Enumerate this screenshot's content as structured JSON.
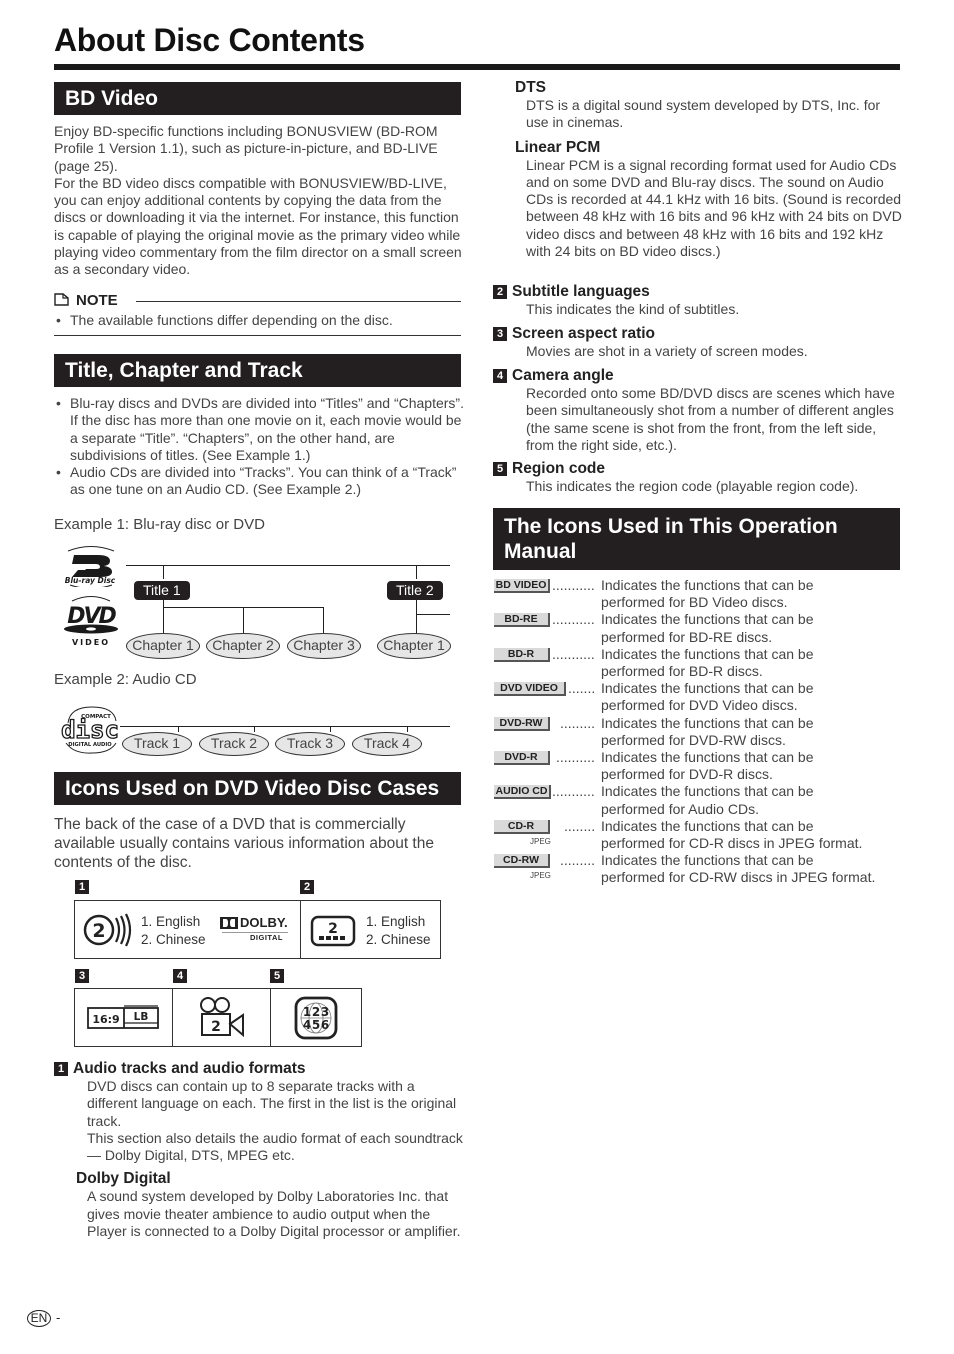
{
  "page": {
    "title": "About Disc Contents",
    "footer": {
      "lang_badge": "EN",
      "page_suffix": "-"
    }
  },
  "bd_video": {
    "heading": "BD Video",
    "paragraph1": "Enjoy BD-specific functions including BONUSVIEW (BD-ROM Profile 1 Version 1.1), such as picture-in-picture, and BD-LIVE (page 25).",
    "paragraph2": "For the BD video discs compatible with BONUSVIEW/BD-LIVE, you can enjoy additional contents by copying the data from the discs or downloading it via the internet. For instance, this function is capable of playing the original movie as the primary video while playing video commentary from the film director on a small screen as a secondary video.",
    "note_label": "NOTE",
    "note_items": [
      "The available functions differ depending on the disc."
    ]
  },
  "title_chapter_track": {
    "heading": "Title, Chapter and Track",
    "bullets": [
      "Blu-ray discs and DVDs are divided into “Titles” and “Chapters”. If the disc has more than one movie on it, each movie would be a separate “Title”. “Chapters”, on the other hand, are subdivisions of titles. (See Example 1.)",
      "Audio CDs are divided into “Tracks”. You can think of a “Track” as one tune on an Audio CD. (See Example 2.)"
    ],
    "example1": {
      "label": "Example 1: Blu-ray disc or DVD",
      "logos": [
        "Blu-ray Disc",
        "DVD VIDEO"
      ],
      "titles": [
        "Title 1",
        "Title 2"
      ],
      "chapters": [
        "Chapter 1",
        "Chapter 2",
        "Chapter 3",
        "Chapter 1"
      ]
    },
    "example2": {
      "label": "Example 2: Audio CD",
      "logo_top": "COMPACT",
      "logo_main": "disc",
      "logo_bottom": "DIGITAL AUDIO",
      "tracks": [
        "Track 1",
        "Track 2",
        "Track 3",
        "Track 4"
      ]
    }
  },
  "dvd_icons": {
    "heading": "Icons Used on DVD Video Disc Cases",
    "intro": "The back of the case of a DVD that is commercially available usually contains various information about the contents of the disc.",
    "panel": {
      "n1": "1",
      "n2": "2",
      "n3": "3",
      "n4": "4",
      "n5": "5",
      "audio_tracks_count": "2",
      "audio_langs": [
        "1. English",
        "2. Chinese"
      ],
      "dolby_main": "DOLBY.",
      "dolby_sub": "DIGITAL",
      "subtitle_count": "2",
      "subtitle_langs": [
        "1. English",
        "2. Chinese"
      ],
      "aspect": "16:9",
      "aspect_mode": "LB",
      "angle_count": "2",
      "region_digits": [
        "1",
        "2",
        "3",
        "4",
        "5",
        "6"
      ]
    },
    "items": [
      {
        "num": "1",
        "title": "Audio tracks and audio formats",
        "paragraphs": [
          "DVD discs can contain up to 8 separate tracks with a different language on each. The first in the list is the original track.",
          "This section also details the audio format of each soundtrack — Dolby Digital, DTS, MPEG etc."
        ],
        "subsections": [
          {
            "title": "Dolby Digital",
            "text": "A sound system developed by Dolby Laboratories Inc. that gives movie theater ambience to audio output when the Player is connected to a Dolby Digital processor or amplifier."
          },
          {
            "title": "DTS",
            "text": "DTS is a digital sound system developed by DTS, Inc. for use in cinemas."
          },
          {
            "title": "Linear PCM",
            "text": "Linear PCM is a signal recording format used for Audio CDs and on some DVD and Blu-ray discs. The sound on Audio CDs is recorded at 44.1 kHz with 16 bits. (Sound is recorded between 48 kHz with 16 bits and 96 kHz with 24 bits on DVD video discs and between 48 kHz with 16 bits and 192 kHz with 24 bits on BD video discs.)"
          }
        ]
      },
      {
        "num": "2",
        "title": "Subtitle languages",
        "text": "This indicates the kind of subtitles."
      },
      {
        "num": "3",
        "title": "Screen aspect ratio",
        "text": "Movies are shot in a variety of screen modes."
      },
      {
        "num": "4",
        "title": "Camera angle",
        "text": "Recorded onto some BD/DVD discs are scenes which have been simultaneously shot from a number of different angles (the same scene is shot from the front, from the left side, from the right side, etc.)."
      },
      {
        "num": "5",
        "title": "Region code",
        "text": "This indicates the region code (playable region code)."
      }
    ]
  },
  "manual_icons": {
    "heading": "The Icons Used in This Operation Manual",
    "rows": [
      {
        "badge": "BD VIDEO",
        "dots": "...........",
        "line1": "Indicates the functions that can be",
        "line2": "performed for BD Video discs.",
        "sub": ""
      },
      {
        "badge": "BD-RE",
        "dots": "...........",
        "line1": "Indicates the functions that can be",
        "line2": "performed for BD-RE discs.",
        "sub": ""
      },
      {
        "badge": "BD-R",
        "dots": "...........",
        "line1": "Indicates the functions that can be",
        "line2": "performed for BD-R discs.",
        "sub": ""
      },
      {
        "badge": "DVD VIDEO",
        "dots": ".......",
        "line1": "Indicates the functions that can be",
        "line2": "performed for DVD Video discs.",
        "sub": ""
      },
      {
        "badge": "DVD-RW",
        "dots": ".........",
        "line1": "Indicates the functions that can be",
        "line2": "performed for DVD-RW discs.",
        "sub": ""
      },
      {
        "badge": "DVD-R",
        "dots": "..........",
        "line1": "Indicates the functions that can be",
        "line2": "performed for DVD-R discs.",
        "sub": ""
      },
      {
        "badge": "AUDIO CD",
        "dots": "...........",
        "line1": "Indicates the functions that can be",
        "line2": "performed for Audio CDs.",
        "sub": ""
      },
      {
        "badge": "CD-R",
        "dots": "........",
        "line1": "Indicates the functions that can be",
        "line2": "performed for CD-R discs in JPEG format.",
        "sub": "JPEG"
      },
      {
        "badge": "CD-RW",
        "dots": ".........",
        "line1": "Indicates the functions that can be",
        "line2": "performed for CD-RW discs in JPEG format.",
        "sub": "JPEG"
      }
    ]
  }
}
